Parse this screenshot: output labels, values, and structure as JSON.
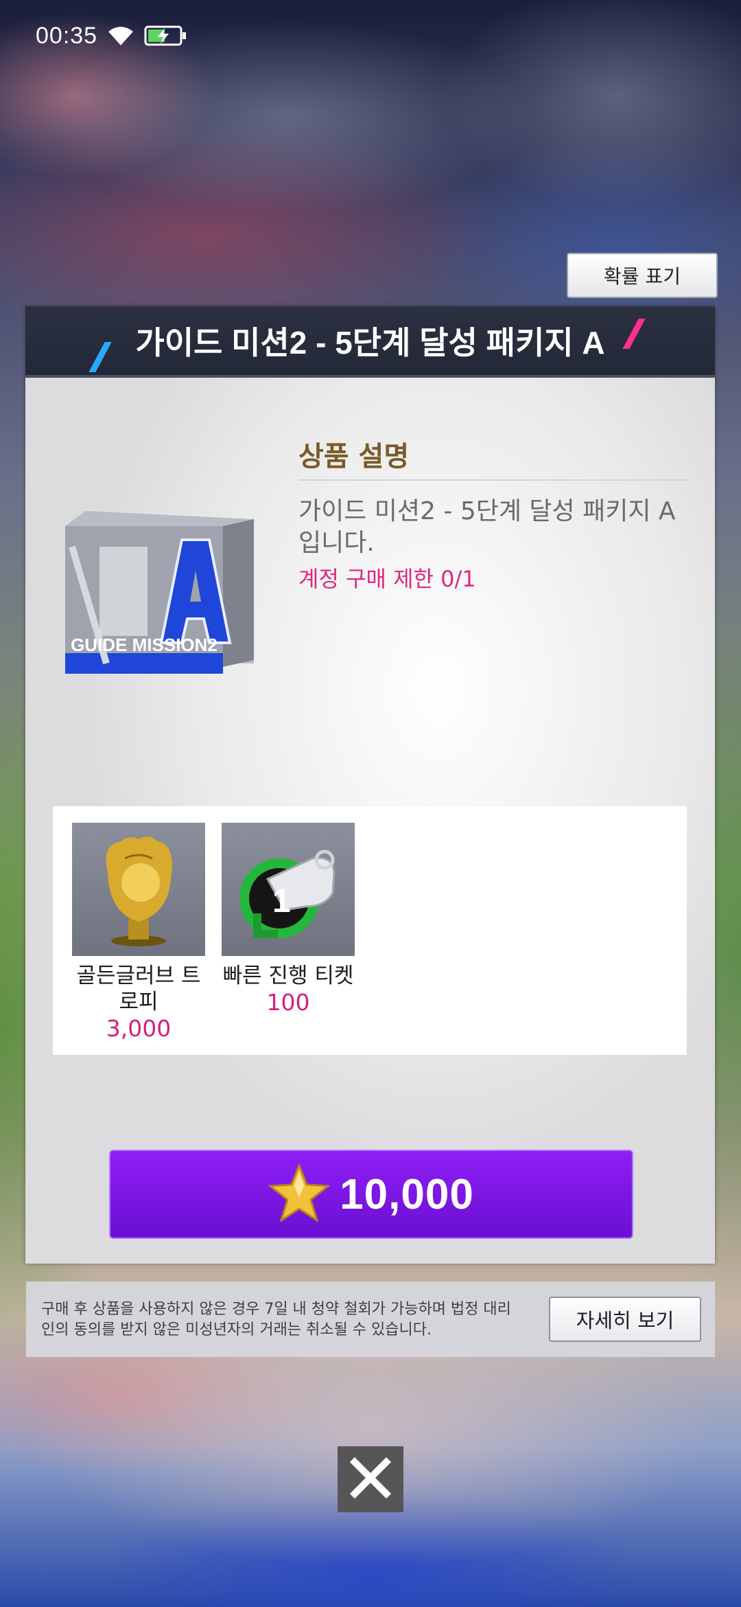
{
  "status_bar": {
    "time": "00:35"
  },
  "probability_button": {
    "label": "확률 표기"
  },
  "dialog": {
    "title": "가이드 미션2 - 5단계 달성 패키지 A",
    "product_image_text": "GUIDE MISSION2",
    "description": {
      "heading": "상품 설명",
      "text": "가이드 미션2 - 5단계 달성 패키지 A입니다.",
      "purchase_limit": "계정 구매 제한 0/1"
    },
    "items": [
      {
        "name": "골든글러브 트로피",
        "quantity": "3,000",
        "icon": "golden-glove-trophy-icon"
      },
      {
        "name": "빠른 진행 티켓",
        "quantity": "100",
        "icon": "whistle-ticket-icon"
      }
    ],
    "buy_button": {
      "price": "10,000",
      "currency_icon": "star-icon"
    }
  },
  "notice": {
    "text": "구매 후 상품을 사용하지 않은 경우 7일 내 청약 철회가 가능하며 법정 대리인의 동의를 받지 않은 미성년자의 거래는 취소될 수 있습니다.",
    "detail_button": "자세히 보기"
  },
  "close_button": {
    "icon": "close-icon"
  },
  "colors": {
    "accent_purple": "#7b14e6",
    "highlight_pink": "#e0267f",
    "header_dark": "#262b3a"
  }
}
